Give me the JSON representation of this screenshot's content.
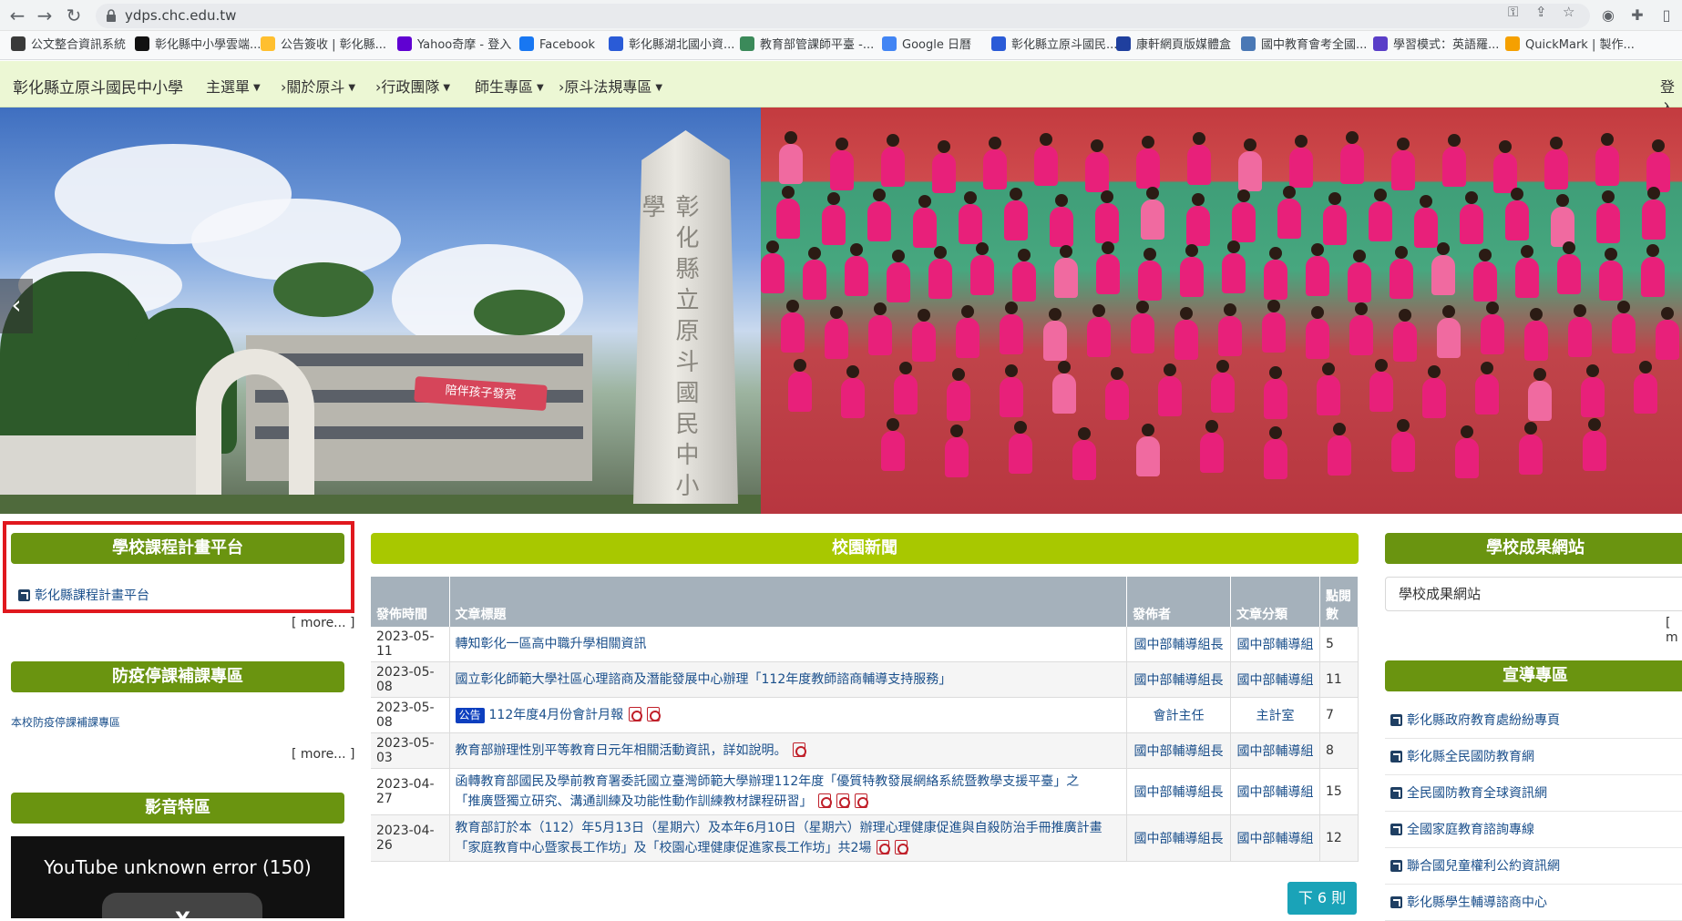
{
  "browser": {
    "url": "ydps.chc.edu.tw",
    "bookmarks": [
      {
        "label": "公文整合資訊系統",
        "color": "#3a3a3a"
      },
      {
        "label": "彰化縣中小學雲端...",
        "color": "#111111"
      },
      {
        "label": "公告簽收 | 彰化縣...",
        "color": "#ffbf2f"
      },
      {
        "label": "Yahoo奇摩 - 登入",
        "color": "#6001d2"
      },
      {
        "label": "Facebook",
        "color": "#1877f2"
      },
      {
        "label": "彰化縣湖北國小資...",
        "color": "#2a5bd7"
      },
      {
        "label": "教育部管課師平臺 -...",
        "color": "#3b8a5a"
      },
      {
        "label": "Google 日曆",
        "color": "#4285f4"
      },
      {
        "label": "彰化縣立原斗國民...",
        "color": "#2a5bd7"
      },
      {
        "label": "康軒網頁版媒體盒",
        "color": "#1f3f9e"
      },
      {
        "label": "國中教育會考全國...",
        "color": "#4a78b5"
      },
      {
        "label": "學習模式：英語羅...",
        "color": "#5a3ec8"
      },
      {
        "label": "QuickMark | 製作...",
        "color": "#f5a000"
      }
    ]
  },
  "site": {
    "brand": "彰化縣立原斗國民中小學",
    "menus": [
      "主選單",
      "›關於原斗",
      "›行政團隊",
      "師生專區",
      "›原斗法規專區"
    ],
    "login": "登入",
    "banner_text": {
      "pillar": "彰化縣立原斗國民中小學",
      "sign": "陪伴孩子發亮"
    }
  },
  "left": {
    "course_panel": {
      "title": "學校課程計畫平台",
      "link": "彰化縣課程計畫平台",
      "more": "[ more... ]"
    },
    "epidemic_panel": {
      "title": "防疫停課補課專區",
      "link": "本校防疫停課補課專區",
      "more": "[ more... ]"
    },
    "video_panel": {
      "title": "影音特區",
      "error": "YouTube unknown error (150)"
    }
  },
  "news": {
    "title": "校園新聞",
    "headers": [
      "發佈時間",
      "文章標題",
      "發佈者",
      "文章分類",
      "點閱數"
    ],
    "rows": [
      {
        "date": "2023-05-11",
        "badge": "",
        "title": "轉知彰化一區高中職升學相關資訊",
        "title2": "",
        "pdfs": 0,
        "pdfs2": 0,
        "author": "國中部輔導組長",
        "cat": "國中部輔導組",
        "hits": "5"
      },
      {
        "date": "2023-05-08",
        "badge": "",
        "title": "國立彰化師範大學社區心理諮商及潛能發展中心辦理「112年度教師諮商輔導支持服務」",
        "title2": "",
        "pdfs": 0,
        "pdfs2": 0,
        "author": "國中部輔導組長",
        "cat": "國中部輔導組",
        "hits": "11"
      },
      {
        "date": "2023-05-08",
        "badge": "公告",
        "title": "112年度4月份會計月報",
        "title2": "",
        "pdfs": 2,
        "pdfs2": 0,
        "author": "會計主任",
        "cat": "主計室",
        "hits": "7"
      },
      {
        "date": "2023-05-03",
        "badge": "",
        "title": "教育部辦理性別平等教育日元年相關活動資訊，詳如說明。",
        "title2": "",
        "pdfs": 1,
        "pdfs2": 0,
        "author": "國中部輔導組長",
        "cat": "國中部輔導組",
        "hits": "8"
      },
      {
        "date": "2023-04-27",
        "badge": "",
        "title": "函轉教育部國民及學前教育署委託國立臺灣師範大學辦理112年度「優質特教發展網絡系統暨教學支援平臺」之",
        "title2": "「推廣暨獨立研究、溝通訓練及功能性動作訓練教材課程研習」",
        "pdfs": 0,
        "pdfs2": 3,
        "author": "國中部輔導組長",
        "cat": "國中部輔導組",
        "hits": "15"
      },
      {
        "date": "2023-04-26",
        "badge": "",
        "title": "教育部訂於本（112）年5月13日（星期六）及本年6月10日（星期六）辦理心理健康促進與自殺防治手冊推廣計畫",
        "title2": "「家庭教育中心暨家長工作坊」及「校園心理健康促進家長工作坊」共2場",
        "pdfs": 0,
        "pdfs2": 2,
        "author": "國中部輔導組長",
        "cat": "國中部輔導組",
        "hits": "12"
      }
    ],
    "next": "下 6 則"
  },
  "right": {
    "achievement": {
      "title": "學校成果網站",
      "box": "學校成果網站",
      "more": "[ m"
    },
    "promo": {
      "title": "宣導專區",
      "links": [
        "彰化縣政府教育處紛紛專頁",
        "彰化縣全民國防教育網",
        "全民國防教育全球資訊網",
        "全國家庭教育諮詢專線",
        "聯合國兒童權利公約資訊網",
        "彰化縣學生輔導諮商中心"
      ]
    }
  }
}
